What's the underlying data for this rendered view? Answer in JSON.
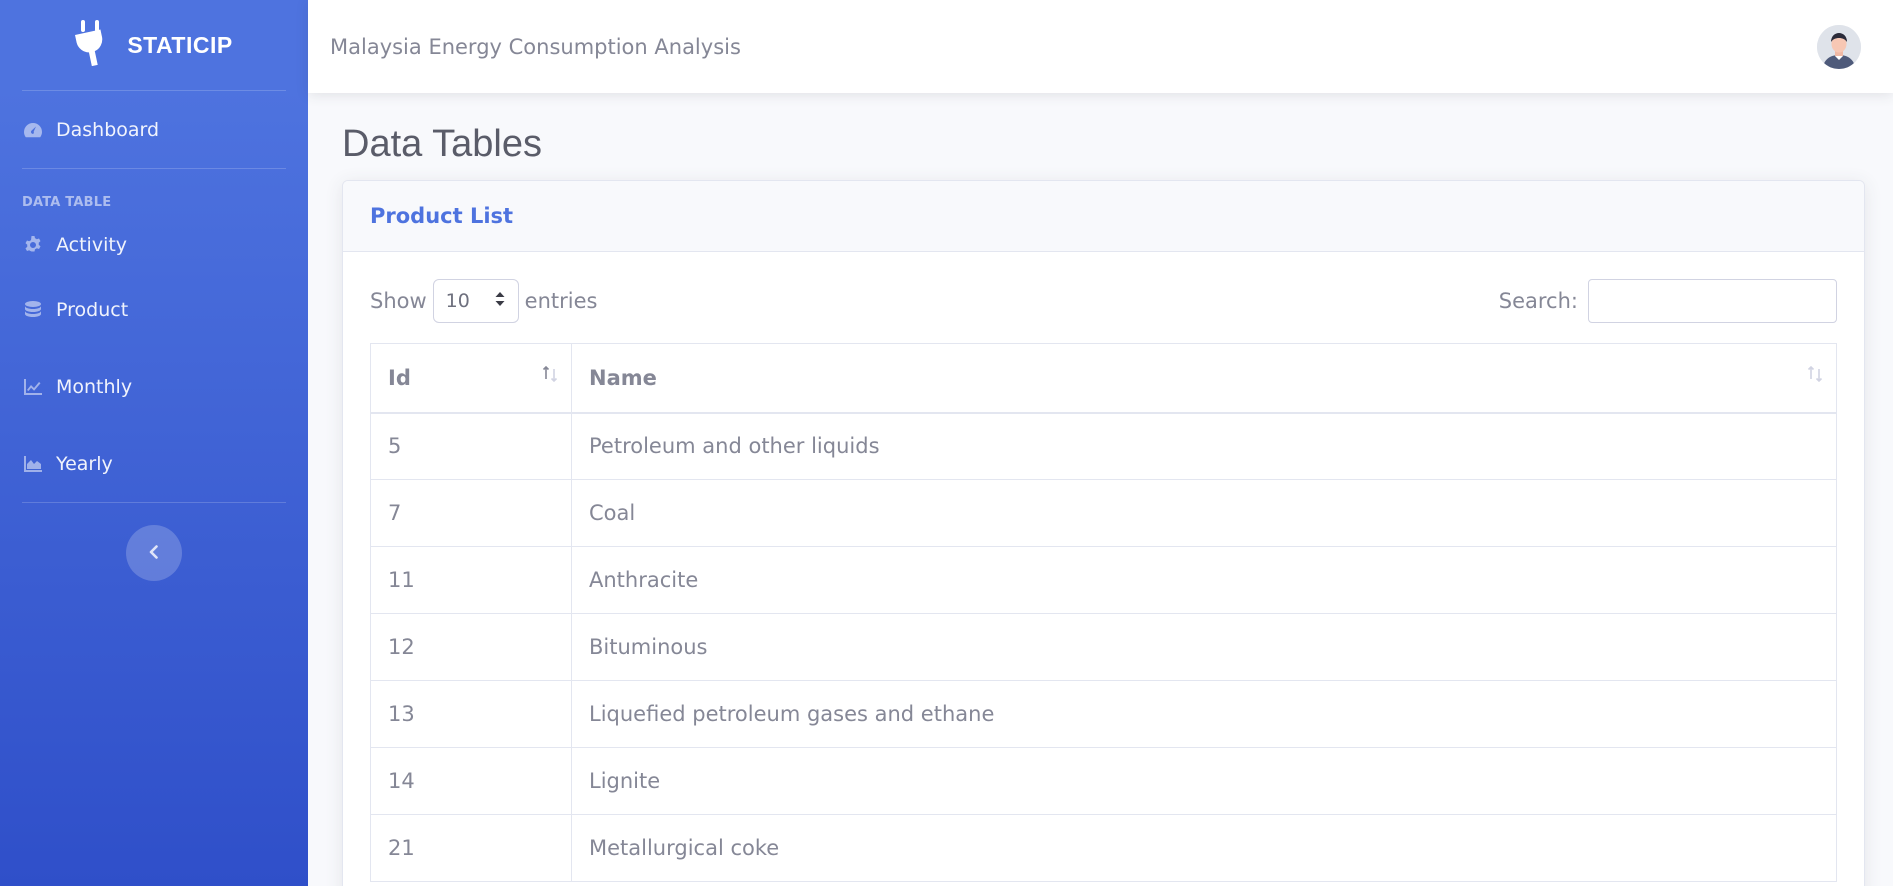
{
  "brand": {
    "name": "STATICIP",
    "icon": "plug-icon"
  },
  "sidebar": {
    "dashboard": {
      "label": "Dashboard",
      "icon": "tachometer-icon"
    },
    "section_heading": "DATA TABLE",
    "items": [
      {
        "label": "Activity",
        "icon": "cog-icon"
      },
      {
        "label": "Product",
        "icon": "database-icon"
      },
      {
        "label": "Monthly",
        "icon": "line-chart-icon"
      },
      {
        "label": "Yearly",
        "icon": "area-chart-icon"
      }
    ],
    "toggle_icon": "chevron-left-icon"
  },
  "topbar": {
    "title": "Malaysia Energy Consumption Analysis",
    "avatar": "user-avatar"
  },
  "page": {
    "title": "Data Tables"
  },
  "card": {
    "title": "Product List",
    "show_label": "Show",
    "entries_value": "10",
    "entries_label": "entries",
    "search_label": "Search:",
    "search_value": ""
  },
  "table": {
    "columns": [
      "Id",
      "Name"
    ],
    "rows": [
      {
        "id": "5",
        "name": "Petroleum and other liquids"
      },
      {
        "id": "7",
        "name": "Coal"
      },
      {
        "id": "11",
        "name": "Anthracite"
      },
      {
        "id": "12",
        "name": "Bituminous"
      },
      {
        "id": "13",
        "name": "Liquefied petroleum gases and ethane"
      },
      {
        "id": "14",
        "name": "Lignite"
      },
      {
        "id": "21",
        "name": "Metallurgical coke"
      }
    ]
  },
  "colors": {
    "primary": "#4e73df",
    "sidebar_bottom": "#2f4fc9",
    "text": "#858796"
  }
}
